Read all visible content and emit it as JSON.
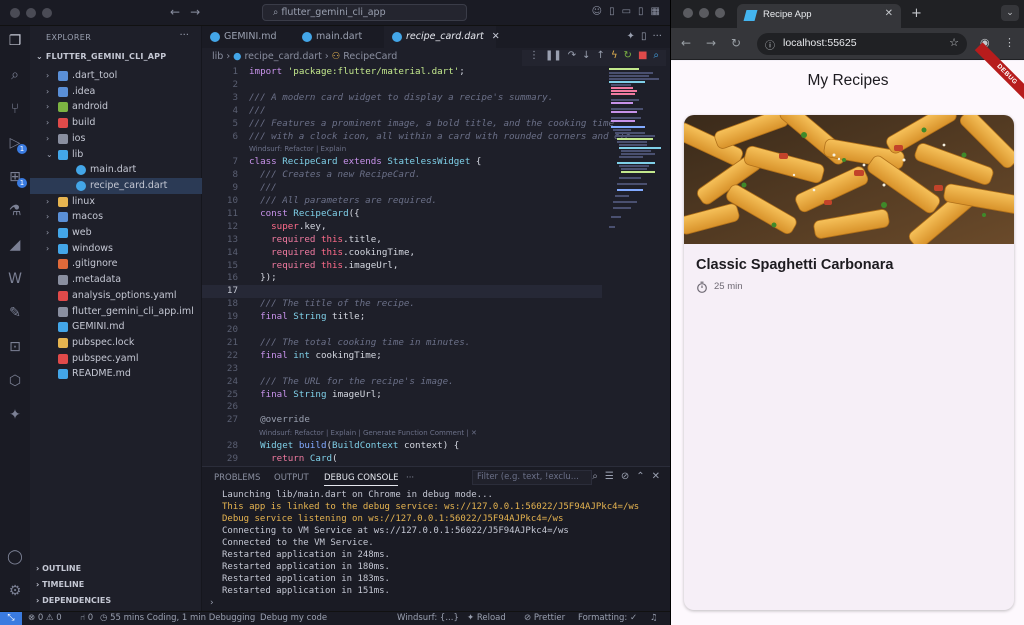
{
  "vscode": {
    "search_text": "flutter_gemini_cli_app",
    "explorer_title": "EXPLORER",
    "project_name": "FLUTTER_GEMINI_CLI_APP",
    "tree": [
      {
        "name": ".dart_tool",
        "type": "folder",
        "depth": 1,
        "color": "#5a8fd6"
      },
      {
        "name": ".idea",
        "type": "folder",
        "depth": 1,
        "color": "#5a8fd6"
      },
      {
        "name": "android",
        "type": "folder",
        "depth": 1,
        "color": "#7cb342"
      },
      {
        "name": "build",
        "type": "folder",
        "depth": 1,
        "color": "#e04a4a"
      },
      {
        "name": "ios",
        "type": "folder",
        "depth": 1,
        "color": "#8a8fa0"
      },
      {
        "name": "lib",
        "type": "folder-open",
        "depth": 1,
        "color": "#43a6e8"
      },
      {
        "name": "main.dart",
        "type": "dart",
        "depth": 2,
        "color": "#43a6e8"
      },
      {
        "name": "recipe_card.dart",
        "type": "dart",
        "depth": 2,
        "color": "#43a6e8",
        "selected": true
      },
      {
        "name": "linux",
        "type": "folder",
        "depth": 1,
        "color": "#e6b450"
      },
      {
        "name": "macos",
        "type": "folder",
        "depth": 1,
        "color": "#5a8fd6"
      },
      {
        "name": "web",
        "type": "folder",
        "depth": 1,
        "color": "#43a6e8"
      },
      {
        "name": "windows",
        "type": "folder",
        "depth": 1,
        "color": "#43a6e8"
      },
      {
        "name": ".gitignore",
        "type": "file",
        "depth": 1,
        "color": "#e06a3a"
      },
      {
        "name": ".metadata",
        "type": "file",
        "depth": 1,
        "color": "#8a8fa0"
      },
      {
        "name": "analysis_options.yaml",
        "type": "file",
        "depth": 1,
        "color": "#e04a4a"
      },
      {
        "name": "flutter_gemini_cli_app.iml",
        "type": "file",
        "depth": 1,
        "color": "#8a8fa0"
      },
      {
        "name": "GEMINI.md",
        "type": "file",
        "depth": 1,
        "color": "#43a6e8"
      },
      {
        "name": "pubspec.lock",
        "type": "file",
        "depth": 1,
        "color": "#e6b450"
      },
      {
        "name": "pubspec.yaml",
        "type": "file",
        "depth": 1,
        "color": "#e04a4a"
      },
      {
        "name": "README.md",
        "type": "file",
        "depth": 1,
        "color": "#43a6e8"
      }
    ],
    "sections": [
      "OUTLINE",
      "TIMELINE",
      "DEPENDENCIES"
    ],
    "tabs": [
      {
        "label": "GEMINI.md",
        "active": false
      },
      {
        "label": "main.dart",
        "active": false
      },
      {
        "label": "recipe_card.dart",
        "active": true
      }
    ],
    "breadcrumb": [
      "lib",
      "recipe_card.dart",
      "RecipeCard"
    ],
    "panel_tabs": [
      "PROBLEMS",
      "OUTPUT",
      "DEBUG CONSOLE"
    ],
    "panel_filter_placeholder": "Filter (e.g. text, !exclu...",
    "console": [
      {
        "text": "Launching lib/main.dart on Chrome in debug mode...",
        "level": "normal"
      },
      {
        "text": "This app is linked to the debug service: ws://127.0.0.1:56022/J5F94AJPkc4=/ws",
        "level": "warn"
      },
      {
        "text": "Debug service listening on ws://127.0.0.1:56022/J5F94AJPkc4=/ws",
        "level": "warn"
      },
      {
        "text": "Connecting to VM Service at ws://127.0.0.1:56022/J5F94AJPkc4=/ws",
        "level": "normal"
      },
      {
        "text": "Connected to the VM Service.",
        "level": "normal"
      },
      {
        "text": "Restarted application in 248ms.",
        "level": "normal"
      },
      {
        "text": "Restarted application in 180ms.",
        "level": "normal"
      },
      {
        "text": "Restarted application in 183ms.",
        "level": "normal"
      },
      {
        "text": "Restarted application in 151ms.",
        "level": "normal"
      }
    ],
    "status": {
      "problems": "⊗ 0 ⚠ 0",
      "ports": "⑁ 0",
      "time": "55 mins Coding, 1 min Debugging",
      "debug": "Debug my code",
      "windsurf": "Windsurf: {...}",
      "reload": "Reload",
      "prettier": "Prettier",
      "formatting": "Formatting: ✓"
    }
  },
  "chrome": {
    "tab_title": "Recipe App",
    "url": "localhost:55625",
    "app_title": "My Recipes",
    "debug_banner": "DEBUG",
    "recipe": {
      "title": "Classic Spaghetti Carbonara",
      "cooking_time": "25 min"
    }
  }
}
